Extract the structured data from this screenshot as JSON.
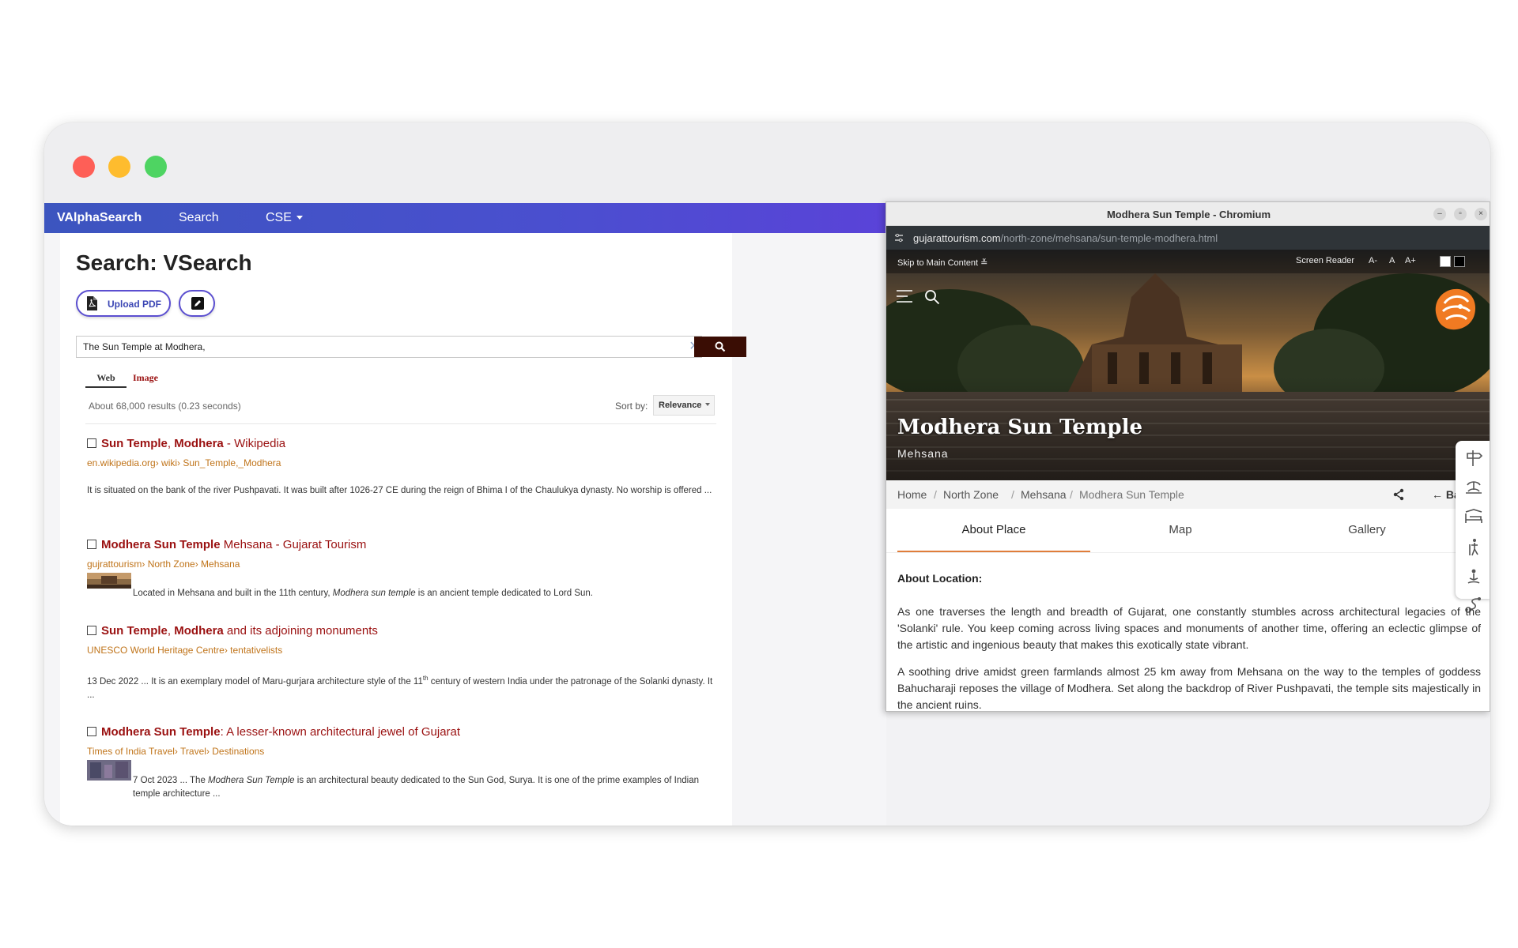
{
  "left_app": {
    "nav": {
      "brand": "VAlphaSearch",
      "search": "Search",
      "cse": "CSE"
    },
    "page_title": "Search: VSearch",
    "upload_label": "Upload PDF",
    "search_query": "The Sun Temple at Modhera,",
    "tabs": {
      "web": "Web",
      "image": "Image"
    },
    "results_meta": "About 68,000 results (0.23 seconds)",
    "sort_label": "Sort by:",
    "sort_value": "Relevance",
    "results": [
      {
        "t1": "Sun Temple",
        "t2": ", ",
        "t3": "Modhera",
        "t4": " - Wikipedia",
        "url": "en.wikipedia.org› wiki› Sun_Temple,_Modhera",
        "snippet": "It is situated on the bank of the river Pushpavati. It was built after 1026-27 CE during the reign of Bhima I of the Chaulukya dynasty. No worship is offered ..."
      },
      {
        "t1": "Modhera Sun Temple",
        "t2": " Mehsana - Gujarat Tourism",
        "url": "gujrattourism› North Zone› Mehsana",
        "snip_a": "Located in Mehsana and built in the 11th century, ",
        "snip_b": "Modhera sun temple",
        "snip_c": " is an ancient temple dedicated to Lord Sun."
      },
      {
        "t1": "Sun Temple",
        "t2": ", ",
        "t3": "Modhera",
        "t4": " and its adjoining monuments",
        "url": "UNESCO World Heritage Centre› tentativelists",
        "snip_a": "13 Dec 2022 ... It is an exemplary model of Maru-gurjara architecture style of the 11",
        "snip_sup": "th",
        "snip_c": " century of western India under the patronage of the Solanki dynasty. It ..."
      },
      {
        "t1": "Modhera Sun Temple",
        "t2": ": A lesser-known architectural jewel of Gujarat",
        "url": "Times of India Travel› Travel› Destinations",
        "snip_a": "7 Oct 2023 ... The ",
        "snip_b": "Modhera Sun Temple",
        "snip_c": " is an architectural beauty dedicated to the Sun God, Surya. It is one of the prime examples of Indian temple architecture ..."
      }
    ]
  },
  "chromium": {
    "title": "Modhera Sun Temple - Chromium",
    "url_host": "gujarattourism.com",
    "url_path": "/north-zone/mehsana/sun-temple-modhera.html",
    "access": {
      "skip": "Skip to Main Content",
      "screen_reader": "Screen Reader",
      "a_minus": "A-",
      "a": "A",
      "a_plus": "A+"
    },
    "hero_title": "Modhera Sun Temple",
    "hero_sub": "Mehsana",
    "breadcrumb": [
      "Home",
      "North Zone",
      "Mehsana",
      "Modhera Sun Temple"
    ],
    "back": "Ba",
    "tabs": [
      "About Place",
      "Map",
      "Gallery"
    ],
    "about_heading": "About Location:",
    "para1": "As one traverses the length and breadth of Gujarat, one constantly stumbles across architectural legacies of the 'Solanki' rule. You keep coming across living spaces and monuments of another time, offering an eclectic glimpse of the artistic and ingenious beauty that makes this exotically state vibrant.",
    "para2": "A soothing drive amidst green farmlands almost 25 km away from Mehsana on the way to the temples of goddess Bahucharaji reposes the village of Modhera. Set along the backdrop of River Pushpavati, the temple sits majestically in the ancient ruins."
  },
  "colors": {
    "nav_start": "#3c55bf",
    "nav_end": "#5a43d8",
    "link": "#9a1010",
    "url": "#c0741a",
    "accent": "#e07d3a",
    "submit": "#3a0d04"
  }
}
